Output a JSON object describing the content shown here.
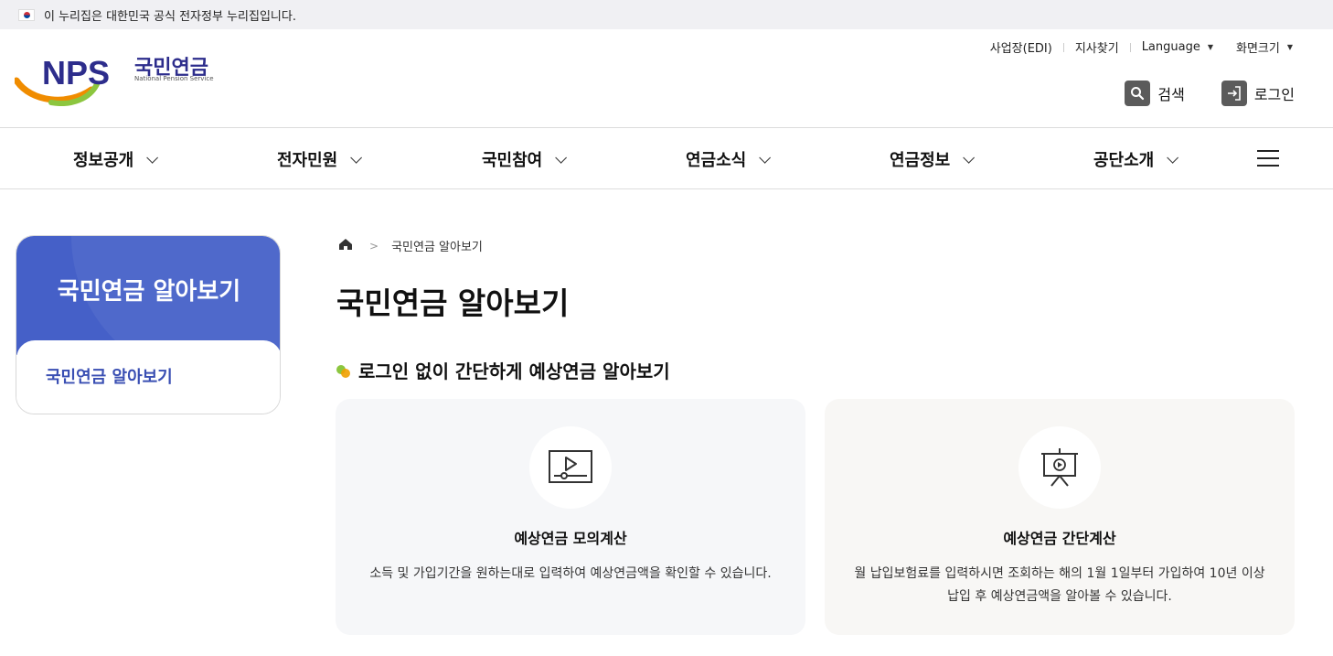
{
  "gov_banner": {
    "text": "이 누리집은 대한민국 공식 전자정부 누리집입니다."
  },
  "logo": {
    "mark": "NPS",
    "name_ko": "국민연금",
    "name_en": "National Pension Service"
  },
  "util_links": [
    {
      "label": "사업장(EDI)"
    },
    {
      "label": "지사찾기"
    },
    {
      "label": "Language"
    },
    {
      "label": "화면크기"
    }
  ],
  "header_buttons": {
    "search": "검색",
    "login": "로그인"
  },
  "gnb": [
    {
      "label": "정보공개"
    },
    {
      "label": "전자민원"
    },
    {
      "label": "국민참여"
    },
    {
      "label": "연금소식"
    },
    {
      "label": "연금정보"
    },
    {
      "label": "공단소개"
    }
  ],
  "sidebar": {
    "title": "국민연금 알아보기",
    "items": [
      {
        "label": "국민연금 알아보기"
      }
    ]
  },
  "breadcrumb": {
    "current": "국민연금 알아보기"
  },
  "page": {
    "title": "국민연금 알아보기",
    "section_title": "로그인 없이 간단하게 예상연금 알아보기"
  },
  "cards": [
    {
      "title": "예상연금 모의계산",
      "desc": "소득 및 가입기간을 원하는대로 입력하여 예상연금액을 확인할 수 있습니다.",
      "icon": "video-player-icon"
    },
    {
      "title": "예상연금 간단계산",
      "desc": "월 납입보험료를 입력하시면 조회하는 해의 1월 1일부터 가입하여 10년 이상 납입 후 예상연금액을 알아볼 수 있습니다.",
      "icon": "presentation-board-icon"
    }
  ],
  "colors": {
    "brand_blue": "#4560c8",
    "brand_navy": "#2d2d8c",
    "accent_orange": "#f08c00",
    "accent_green": "#8cc63f",
    "card1_bg": "#f6f7f9",
    "card2_bg": "#f8f7f5"
  }
}
